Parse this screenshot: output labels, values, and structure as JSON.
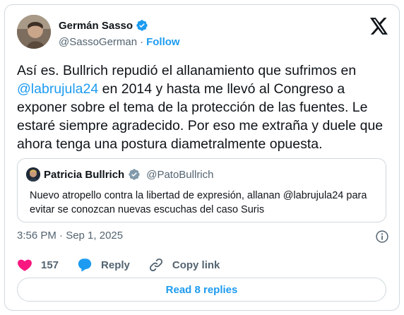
{
  "author": {
    "name": "Germán Sasso",
    "handle": "@SassoGerman",
    "separator": "·",
    "follow_label": "Follow"
  },
  "tweet": {
    "text_part1": "Así es. Bullrich repudió el allanamiento que sufrimos en ",
    "mention": "@labrujula24",
    "text_part2": " en 2014 y hasta me llevó al Congreso a exponer sobre el tema de la protección de las fuentes. Le estaré siempre agradecido. Por eso me extraña y duele que ahora tenga una postura diametralmente opuesta."
  },
  "quoted": {
    "name": "Patricia Bullrich",
    "handle": "@PatoBullrich",
    "text": "Nuevo atropello contra la libertad de expresión, allanan @labrujula24 para evitar se conozcan nuevas escuchas del caso Suris"
  },
  "meta": {
    "timestamp": "3:56 PM · Sep 1, 2025"
  },
  "actions": {
    "like_count": "157",
    "reply_label": "Reply",
    "copy_link_label": "Copy link"
  },
  "footer": {
    "read_replies_label": "Read 8 replies"
  },
  "colors": {
    "accent": "#1d9bf0",
    "like": "#f91880",
    "secondary_text": "#536471",
    "border": "#cfd9de"
  },
  "icons": [
    "verified-badge-icon",
    "x-logo-icon",
    "info-icon",
    "heart-icon",
    "reply-bubble-icon",
    "link-icon"
  ]
}
